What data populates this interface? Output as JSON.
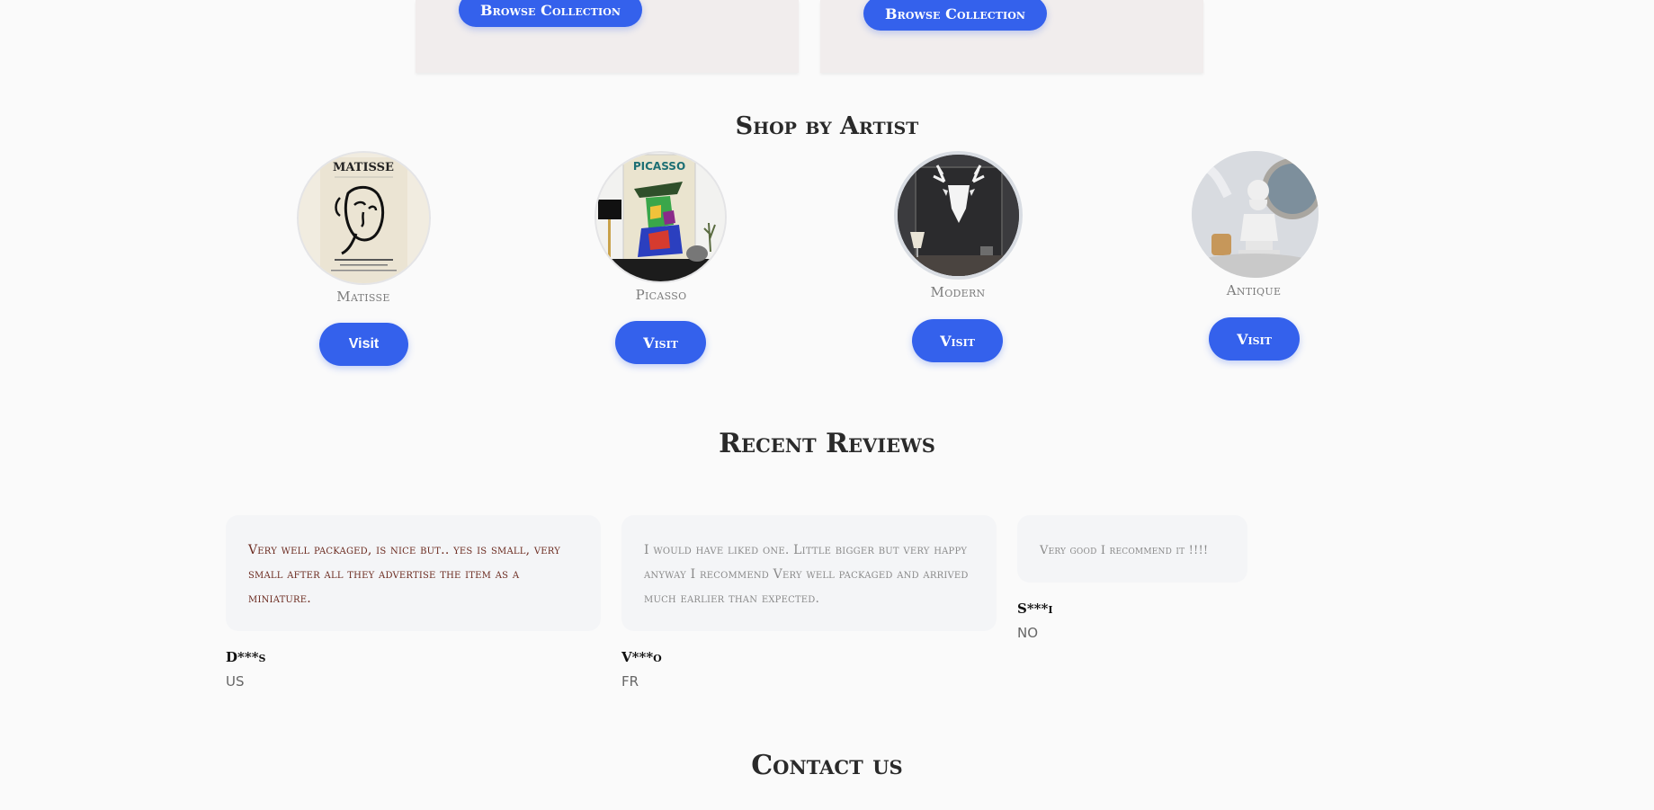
{
  "collections": {
    "browse_label": "Browse Collection"
  },
  "shop_by_artist": {
    "title": "Shop by Artist",
    "artists": [
      {
        "name": "Matisse",
        "button": "Visit"
      },
      {
        "name": "Picasso",
        "button": "Visit"
      },
      {
        "name": "Modern",
        "button": "Visit"
      },
      {
        "name": "Antique",
        "button": "Visit"
      }
    ],
    "poster_text": {
      "matisse_title": "MATISSE",
      "picasso_title": "PICASSO"
    }
  },
  "recent_reviews": {
    "title": "Recent Reviews",
    "reviews": [
      {
        "text": "Very well packaged, is nice but.. yes is small, very small after all they advertise the item as a miniature.",
        "author": "D***s",
        "country": "US"
      },
      {
        "text": "I would have liked one. Little bigger but very happy anyway I recommend Very well packaged and arrived much earlier than expected.",
        "author": "V***o",
        "country": "FR"
      },
      {
        "text": "Very good I recommend it !!!!",
        "author": "S***i",
        "country": "NO"
      }
    ]
  },
  "contact": {
    "title": "Contact us"
  },
  "colors": {
    "accent": "#3461ec",
    "card_bg": "#f1eded",
    "review_bg": "#f4f5f7",
    "review_text_1": "#6b2a1f",
    "review_text_muted": "#8a8a8a"
  }
}
